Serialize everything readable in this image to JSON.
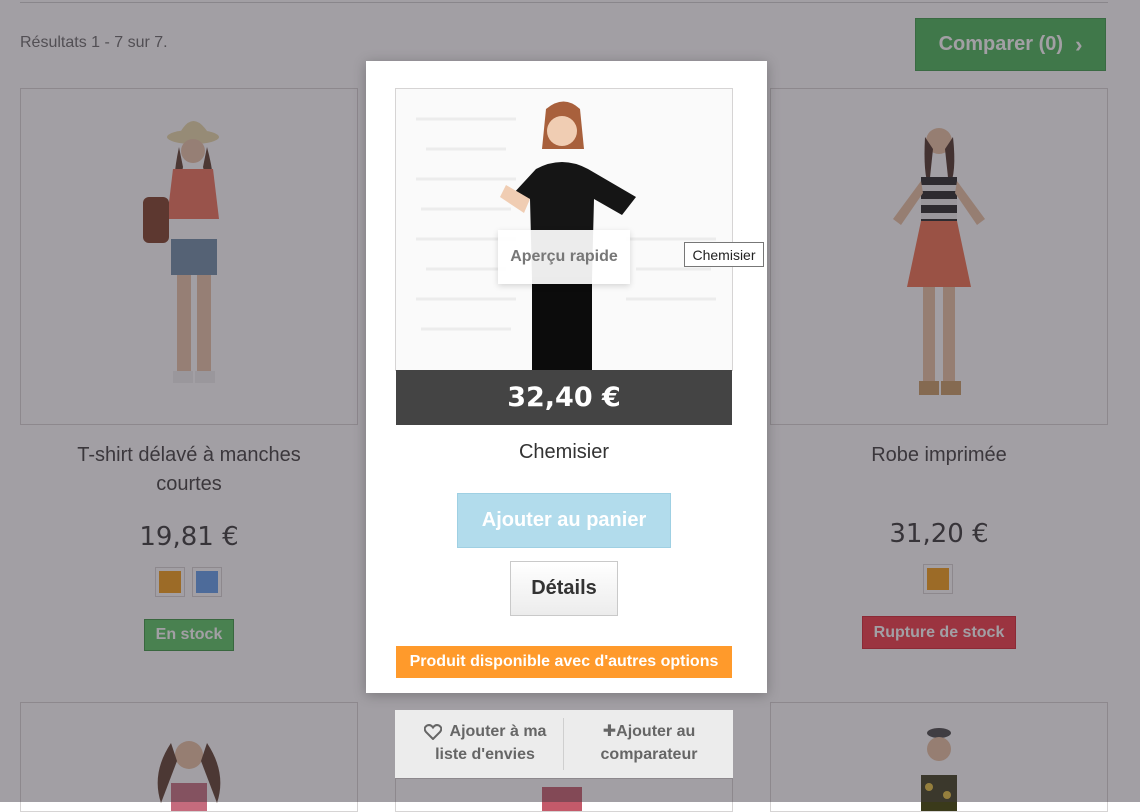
{
  "toolbar": {
    "results_text": "Résultats 1 - 7 sur 7.",
    "compare_label": "Comparer (0)",
    "compare_icon": "chevron-right-icon"
  },
  "products": [
    {
      "name_line1": "T-shirt délavé à manches",
      "name_line2": "courtes",
      "price": "19,81 €",
      "swatches": [
        "#f39c11",
        "#5d9cec"
      ],
      "availability": "En stock",
      "availability_color": "#55c65e"
    },
    {
      "name": "Robe imprimée",
      "price": "31,20 €",
      "swatches": [
        "#f39c11"
      ],
      "availability": "Rupture de stock",
      "availability_color": "#f13340"
    }
  ],
  "hover_card": {
    "name": "Chemisier",
    "price": "32,40 €",
    "quick_view": "Aperçu rapide",
    "add_to_cart": "Ajouter au panier",
    "details": "Détails",
    "options_notice": "Produit disponible avec d'autres options",
    "tooltip": "Chemisier",
    "wishlist_line1": "Ajouter à ma",
    "wishlist_line2": "liste d'envies",
    "compare_line1": "Ajouter au",
    "compare_line2": "comparateur"
  },
  "colors": {
    "compare_green": "#46a74e",
    "price_bar": "#444444",
    "options_orange": "#ff9a2b",
    "cart_blue_disabled": "#b2dcec"
  }
}
